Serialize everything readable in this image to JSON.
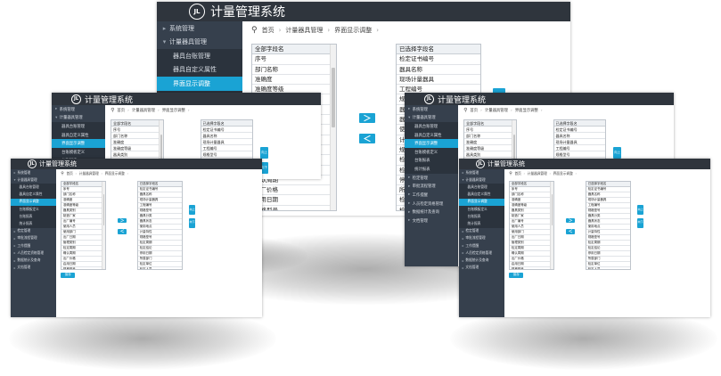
{
  "app": {
    "title": "计量管理系统",
    "logo_text": "JL"
  },
  "breadcrumb": [
    "首页",
    "计量器具管理",
    "界面显示调整"
  ],
  "sidebar_items": [
    {
      "label": "系统管理",
      "level": 0,
      "arrow": "▸"
    },
    {
      "label": "计量器具管理",
      "level": 0,
      "arrow": "▾"
    },
    {
      "label": "器具台账管理",
      "level": 1
    },
    {
      "label": "器具自定义属性",
      "level": 1
    },
    {
      "label": "界面显示调整",
      "level": 1,
      "active": true
    },
    {
      "label": "台账模板定义",
      "level": 1
    },
    {
      "label": "台账报表",
      "level": 1
    },
    {
      "label": "统计报表",
      "level": 1
    },
    {
      "label": "检定管理",
      "level": 0,
      "arrow": "▸"
    },
    {
      "label": "审批流程管理",
      "level": 0,
      "arrow": "▸"
    },
    {
      "label": "工作提醒",
      "level": 0,
      "arrow": "▸"
    },
    {
      "label": "人员检定资格管理",
      "level": 0,
      "arrow": "▸"
    },
    {
      "label": "数据统计及查询",
      "level": 0,
      "arrow": "▸"
    },
    {
      "label": "文档管理",
      "level": 0,
      "arrow": "▸"
    }
  ],
  "all_fields": {
    "title": "全部字段名",
    "items": [
      "序号",
      "部门名称",
      "准确度",
      "准确度等级",
      "器具类别",
      "制造厂家",
      "出厂编号",
      "使用人员",
      "使用部门",
      "出厂日期",
      "管理类别",
      "检定周期",
      "确认周期",
      "出厂价格",
      "启用日期",
      "规格型号"
    ]
  },
  "selected_fields": {
    "title": "已选择字段名",
    "items": [
      "检定证书编号",
      "器具名称",
      "现场计量器具",
      "工程编号",
      "规格型号",
      "器具分类",
      "器具状态",
      "使用地点",
      "计量特性",
      "规格型号",
      "检定周期",
      "检定结论",
      "停用日期",
      "所属部门",
      "检定单位",
      "检定人员"
    ]
  },
  "buttons": {
    "move_right": "＞",
    "move_left": "＜",
    "move_up": "向上",
    "move_down": "向下",
    "save": "保存"
  },
  "colors": {
    "titlebar": "#2f353d",
    "sidebar": "#36404d",
    "accent": "#1aa3d4"
  }
}
